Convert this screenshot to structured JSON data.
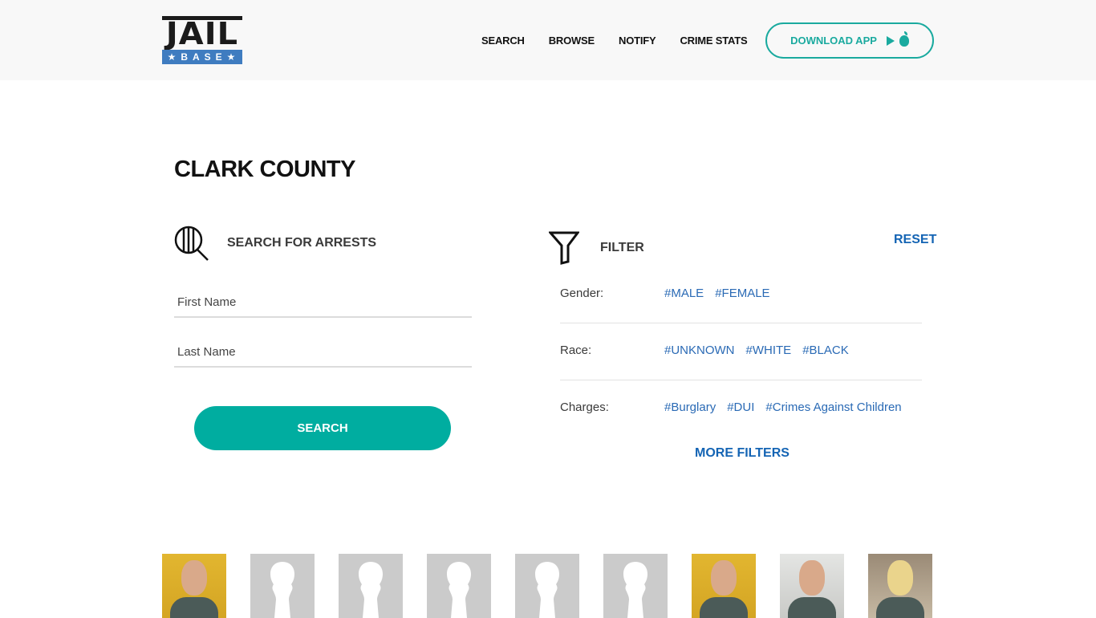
{
  "brand": {
    "logo_top": "JAIL",
    "logo_bottom": "★BASE★"
  },
  "nav": {
    "items": [
      "SEARCH",
      "BROWSE",
      "NOTIFY",
      "CRIME STATS"
    ],
    "download_label": "DOWNLOAD APP"
  },
  "colors": {
    "accent": "#00ada0",
    "link": "#1464b4",
    "tag": "#2a6ab5"
  },
  "page": {
    "title": "CLARK COUNTY"
  },
  "search": {
    "heading": "SEARCH FOR ARRESTS",
    "first_name_placeholder": "First Name",
    "last_name_placeholder": "Last Name",
    "first_name_value": "",
    "last_name_value": "",
    "button_label": "SEARCH"
  },
  "filter": {
    "heading": "FILTER",
    "reset_label": "RESET",
    "rows": [
      {
        "label": "Gender:",
        "tags": [
          "#MALE",
          "#FEMALE"
        ]
      },
      {
        "label": "Race:",
        "tags": [
          "#UNKNOWN",
          "#WHITE",
          "#BLACK"
        ]
      },
      {
        "label": "Charges:",
        "tags": [
          "#Burglary",
          "#DUI",
          "#Crimes Against Children"
        ]
      }
    ],
    "more_label": "MORE FILTERS"
  },
  "mugshots": [
    {
      "type": "photo",
      "style": "yellow"
    },
    {
      "type": "placeholder"
    },
    {
      "type": "placeholder"
    },
    {
      "type": "placeholder"
    },
    {
      "type": "placeholder"
    },
    {
      "type": "placeholder"
    },
    {
      "type": "photo",
      "style": "yellow"
    },
    {
      "type": "photo",
      "style": "grey"
    },
    {
      "type": "photo",
      "style": "brown"
    }
  ]
}
